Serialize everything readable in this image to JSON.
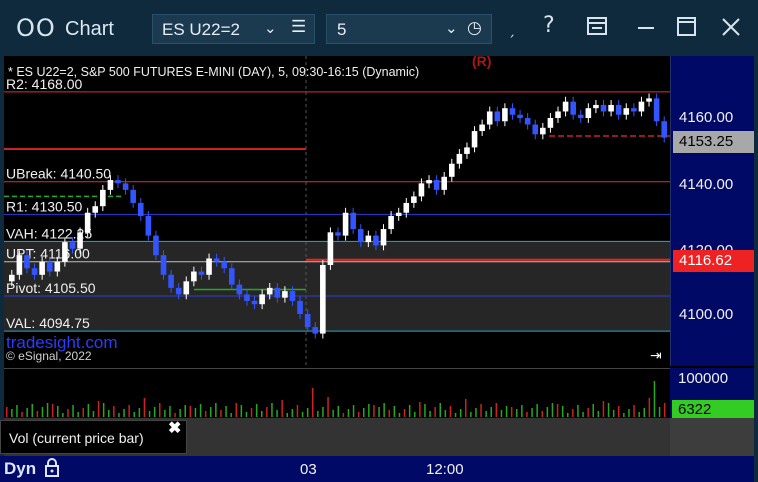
{
  "window": {
    "icon": "OO",
    "title": "Chart",
    "symbol": "ES U22=2",
    "interval": "5",
    "buttons": {
      "cursor": "ˏ",
      "help": "?",
      "layout": "layout-icon",
      "minimize": "minimize-icon",
      "maximize": "maximize-icon",
      "close": "close-icon"
    }
  },
  "chart": {
    "header": "* ES U22=2, S&P 500 FUTURES E-MINI (DAY), 5, 09:30-16:15 (Dynamic)",
    "marker_r": "(R)",
    "watermark": "tradesight.com",
    "copyright": "© eSignal, 2022",
    "levels": [
      {
        "label": "R2: 4168.00",
        "price": 4168.0,
        "color": "#e03030"
      },
      {
        "label": "UBreak: 4140.50",
        "price": 4140.5,
        "color": "#e03030"
      },
      {
        "label": "R1: 4130.50",
        "price": 4130.5,
        "color": "#2a3dd8"
      },
      {
        "label": "VAH: 4122.25",
        "price": 4122.25,
        "color": "#26a8c8"
      },
      {
        "label": "UPT: 4116.00",
        "price": 4116.0,
        "color": "#c0c0c0"
      },
      {
        "label": "Pivot: 4105.50",
        "price": 4105.5,
        "color": "#2a3dd8"
      },
      {
        "label": "VAL: 4094.75",
        "price": 4094.75,
        "color": "#26a8c8"
      }
    ],
    "price_axis": [
      "4160.00",
      "4140.00",
      "4120.00",
      "4100.00"
    ],
    "last_price": "4153.25",
    "level_price": "4116.62"
  },
  "volume": {
    "axis_max": "100000",
    "current": "6322",
    "label": "Vol (current price bar)"
  },
  "timebar": {
    "mode": "Dyn",
    "ticks": [
      "03",
      "12:00"
    ]
  },
  "colors": {
    "titlebar": "#0e2a3c",
    "axis": "#000a66",
    "up_bar": "#ffffff",
    "down_bar": "#3355ff",
    "last_price_tag": "#a8a8a8",
    "level_tag": "#ee2222",
    "volume_tag": "#33cc22"
  }
}
